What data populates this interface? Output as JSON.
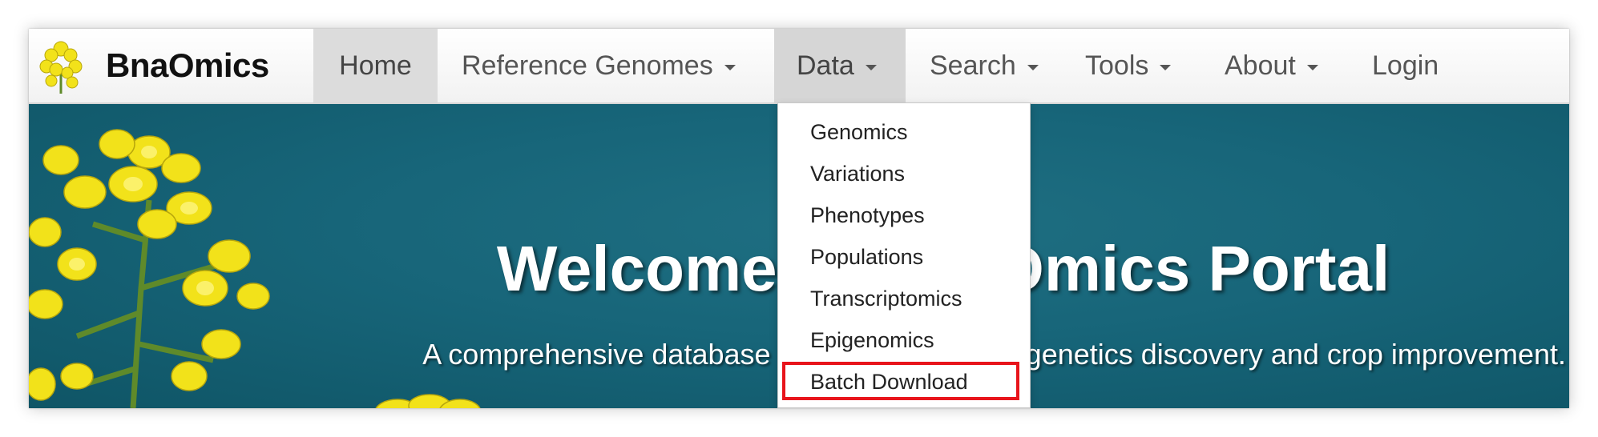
{
  "brand": {
    "name": "BnaOmics",
    "logo_icon": "rapeseed-flower-logo-icon"
  },
  "nav": {
    "home": "Home",
    "reference_genomes": "Reference Genomes",
    "data": "Data",
    "search": "Search",
    "tools": "Tools",
    "about": "About",
    "login": "Login"
  },
  "data_menu": {
    "items": [
      "Genomics",
      "Variations",
      "Phenotypes",
      "Populations",
      "Transcriptomics",
      "Epigenomics",
      "Batch Download"
    ],
    "highlighted": "Batch Download",
    "highlight_color": "#e8141b"
  },
  "hero": {
    "title": "Welcome to BnaOmics Portal",
    "subtitle": "A comprehensive database for Brassica napus genetics discovery and crop improvement.",
    "background_color": "#176579"
  },
  "colors": {
    "flower": "#f2e21a",
    "stem": "#5f8a2a"
  }
}
